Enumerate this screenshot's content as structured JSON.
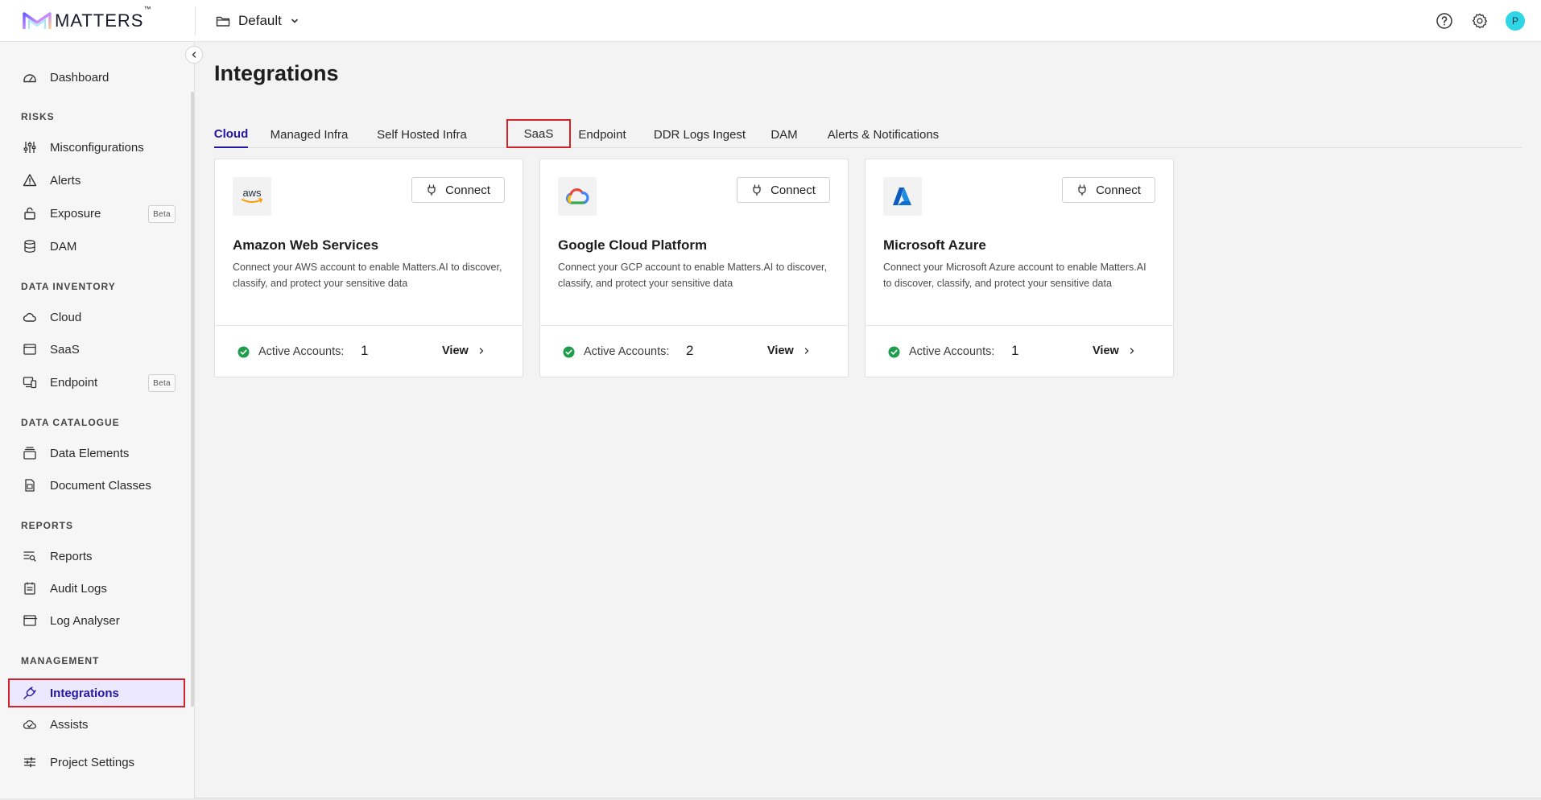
{
  "brand": {
    "name": "MATTERS",
    "tm": "™"
  },
  "project": {
    "name": "Default"
  },
  "user": {
    "initial": "P"
  },
  "sidebar": {
    "items": {
      "dashboard": "Dashboard",
      "misconfigurations": "Misconfigurations",
      "alerts": "Alerts",
      "exposure": "Exposure",
      "dam": "DAM",
      "cloud": "Cloud",
      "saas": "SaaS",
      "endpoint": "Endpoint",
      "data_elements": "Data Elements",
      "document_classes": "Document Classes",
      "reports": "Reports",
      "audit_logs": "Audit Logs",
      "log_analyser": "Log Analyser",
      "integrations": "Integrations",
      "assists": "Assists",
      "project_settings": "Project Settings"
    },
    "sections": {
      "risks": "RISKS",
      "data_inventory": "DATA INVENTORY",
      "data_catalogue": "DATA CATALOGUE",
      "reports": "REPORTS",
      "management": "MANAGEMENT"
    },
    "beta_label": "Beta",
    "active_item": "Integrations"
  },
  "main": {
    "title": "Integrations",
    "tabs": [
      "Cloud",
      "Managed Infra",
      "Self Hosted Infra",
      "SaaS",
      "Endpoint",
      "DDR Logs Ingest",
      "DAM",
      "Alerts & Notifications"
    ],
    "active_tab": "Cloud",
    "highlighted_tab": "SaaS",
    "cards": [
      {
        "name": "Amazon Web Services",
        "logo_text": "aws",
        "description": "Connect your AWS account to enable Matters.AI to discover, classify, and protect your sensitive data",
        "connect_label": "Connect",
        "accounts_label": "Active Accounts:",
        "accounts_count": "1",
        "view_label": "View"
      },
      {
        "name": "Google Cloud Platform",
        "description": "Connect your GCP account to enable Matters.AI to discover, classify, and protect your sensitive data",
        "connect_label": "Connect",
        "accounts_label": "Active Accounts:",
        "accounts_count": "2",
        "view_label": "View"
      },
      {
        "name": "Microsoft Azure",
        "description": "Connect your Microsoft Azure account to enable Matters.AI to discover, classify, and protect your sensitive data",
        "connect_label": "Connect",
        "accounts_label": "Active Accounts:",
        "accounts_count": "1",
        "view_label": "View"
      }
    ]
  },
  "colors": {
    "accent": "#2317a6",
    "highlight_border": "#d1232a",
    "active_status": "#1f9d4c",
    "avatar": "#2fd6e6"
  }
}
